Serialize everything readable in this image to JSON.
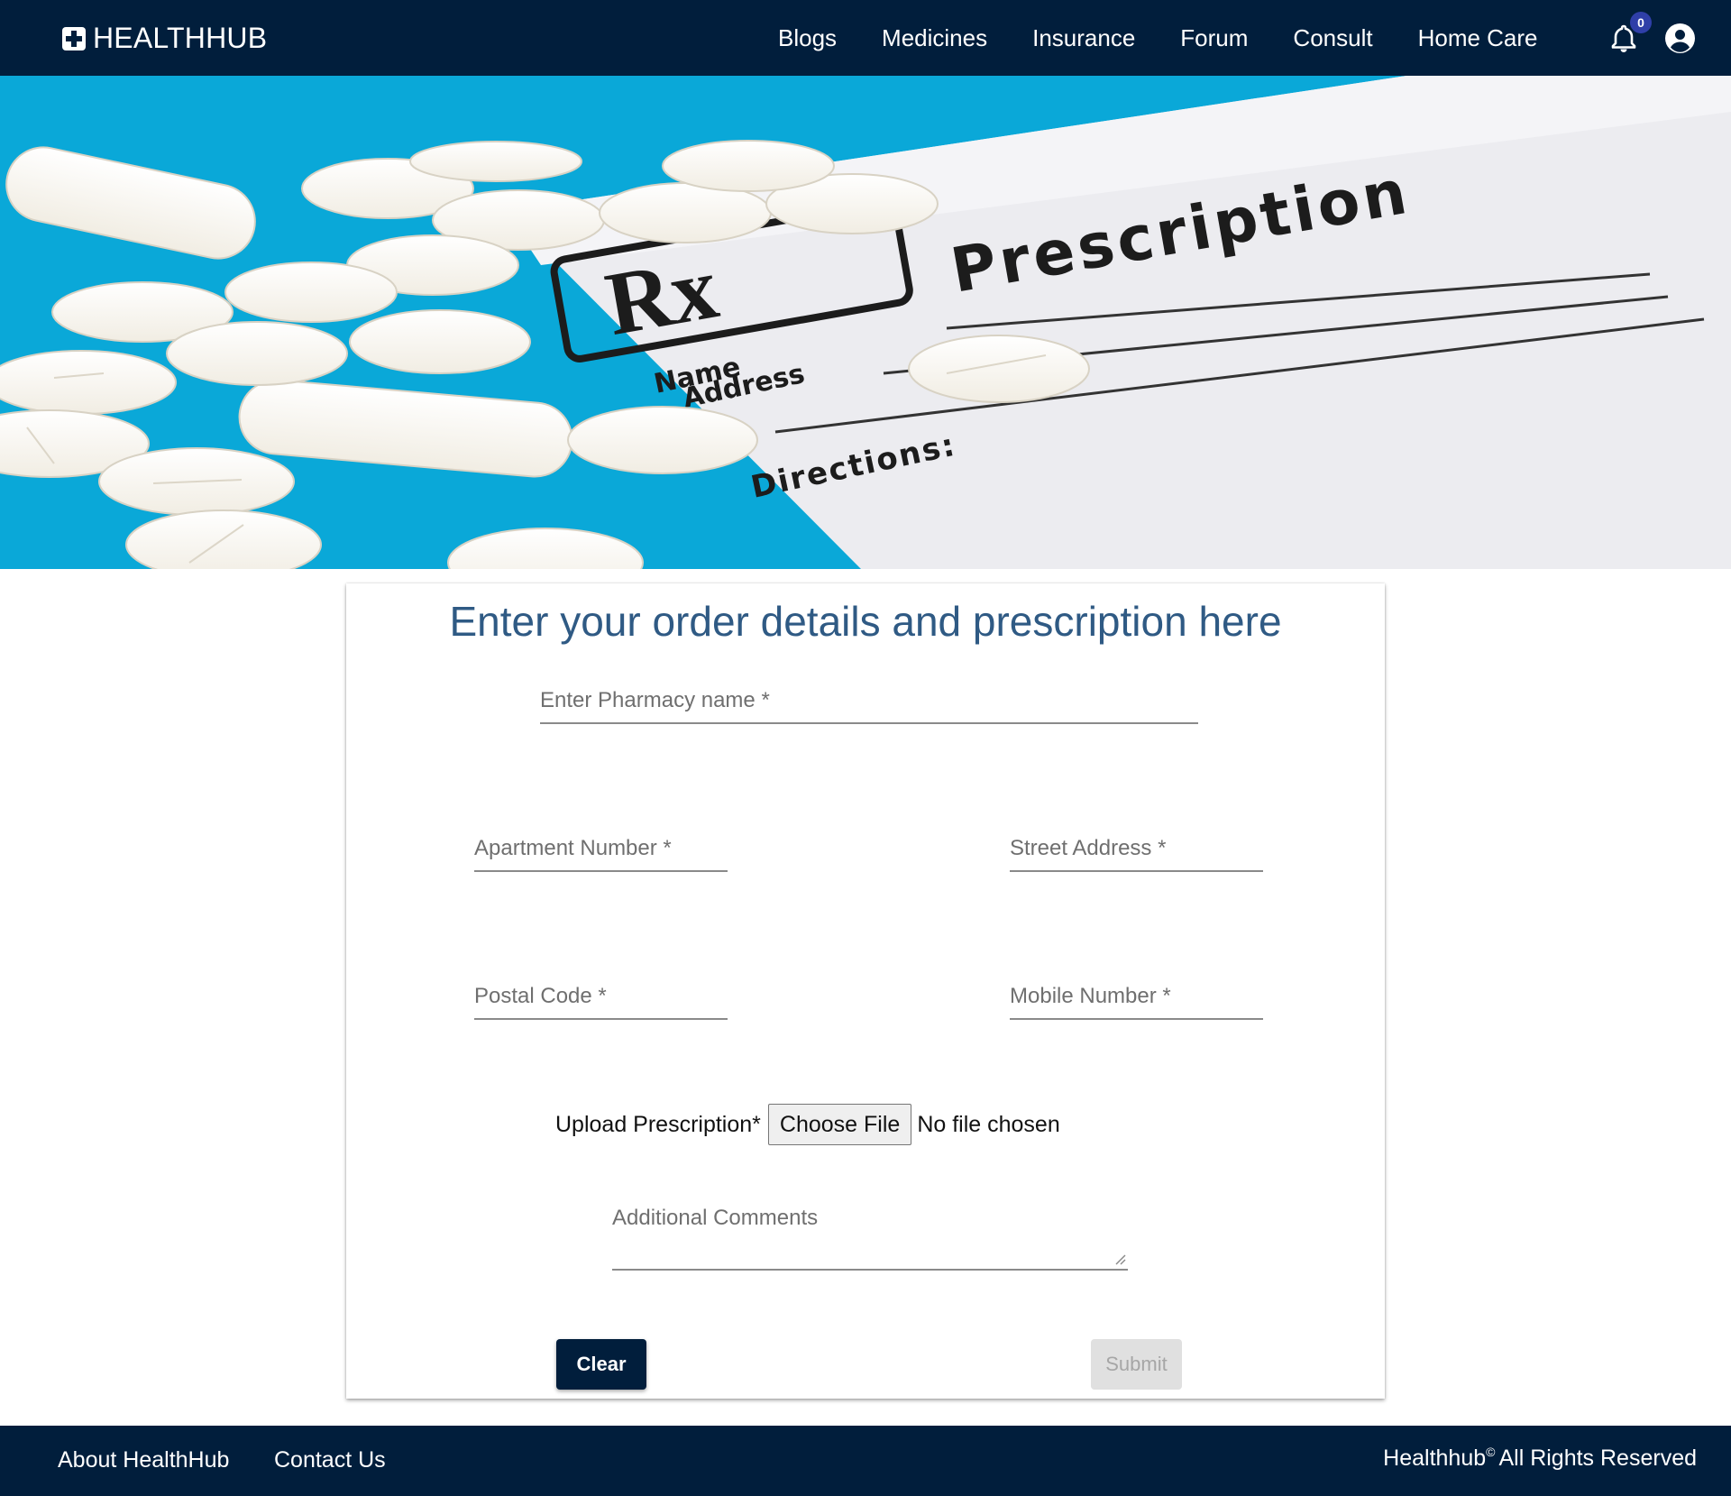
{
  "brand": {
    "name": "HEALTHHUB"
  },
  "nav": {
    "links": [
      "Blogs",
      "Medicines",
      "Insurance",
      "Forum",
      "Consult",
      "Home Care"
    ],
    "notification_count": "0",
    "icons": {
      "notifications": "bell-icon",
      "account": "account-circle-icon"
    }
  },
  "hero": {
    "sheet_title": "Prescription",
    "rx": "Rx",
    "name_label": "Name",
    "address_label": "Address",
    "directions_label": "Directions:"
  },
  "form": {
    "title": "Enter your order details and prescription here",
    "pharmacy_placeholder": "Enter Pharmacy name *",
    "apartment_placeholder": "Apartment Number *",
    "street_placeholder": "Street Address *",
    "postal_placeholder": "Postal Code *",
    "mobile_placeholder": "Mobile Number *",
    "upload_label": "Upload Prescription*",
    "choose_file_label": "Choose File",
    "file_status": "No file chosen",
    "comments_placeholder": "Additional Comments",
    "clear_label": "Clear",
    "submit_label": "Submit"
  },
  "footer": {
    "about": "About HealthHub",
    "contact": "Contact Us",
    "copyright_name": "Healthhub",
    "copyright_mark": "©",
    "copyright_text": "All Rights Reserved"
  },
  "colors": {
    "navy": "#011e3c",
    "title_blue": "#2f5a84",
    "badge": "#2f3fa8",
    "hero_blue": "#0aa8d8"
  }
}
